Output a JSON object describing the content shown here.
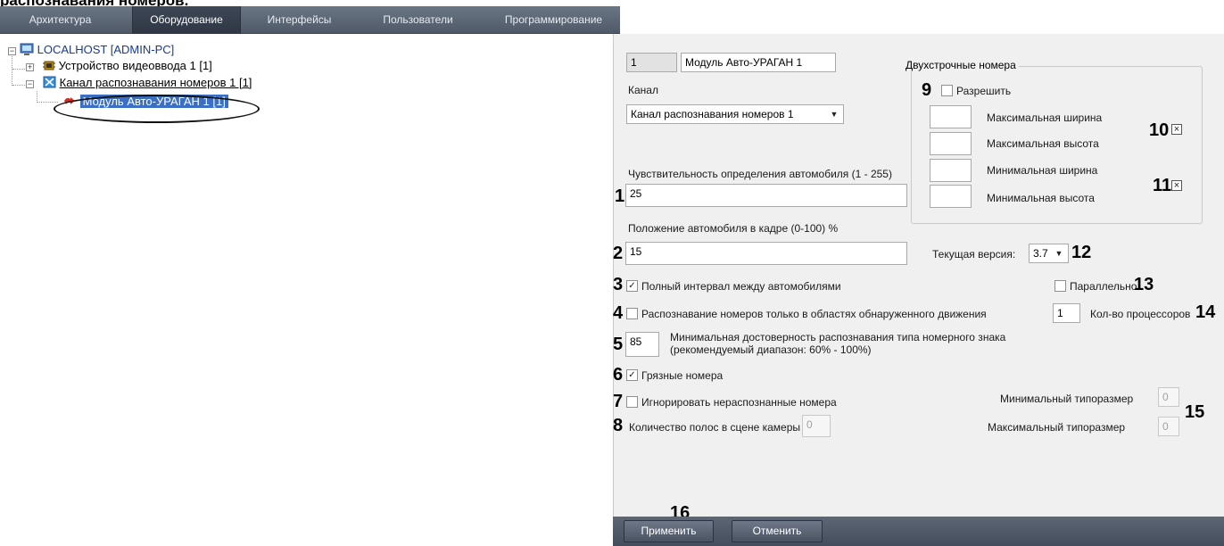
{
  "caption_fragment": "распознавания номеров.",
  "tabs": [
    {
      "label": "Архитектура"
    },
    {
      "label": "Оборудование"
    },
    {
      "label": "Интерфейсы"
    },
    {
      "label": "Пользователи"
    },
    {
      "label": "Программирование"
    }
  ],
  "tree": {
    "root": "LOCALHOST [ADMIN-PC]",
    "video_device": "Устройство видеоввода 1 [1]",
    "recognition_channel": "Канал распознавания номеров 1 [1]",
    "module": "Модуль Авто-УРАГАН 1 [1]"
  },
  "settings": {
    "id_value": "1",
    "name_value": "Модуль Авто-УРАГАН 1",
    "channel_label": "Канал",
    "channel_value": "Канал распознавания номеров 1",
    "sensitivity_label": "Чувствительность определения автомобиля (1 - 255)",
    "sensitivity_value": "25",
    "position_label": "Положение автомобиля в кадре (0-100) %",
    "position_value": "15",
    "full_interval_label": "Полный интервал между автомобилями",
    "full_interval_checked": true,
    "motion_only_label": "Распознавание номеров только в областях обнаруженного движения",
    "motion_only_checked": false,
    "min_confidence_value": "85",
    "min_confidence_label_line1": "Минимальная достоверность распознавания типа номерного знака",
    "min_confidence_label_line2": "(рекомендуемый диапазон: 60% - 100%)",
    "dirty_label": "Грязные номера",
    "dirty_checked": true,
    "ignore_label": "Игнорировать нераспознанные номера",
    "ignore_checked": false,
    "lanes_label": "Количество полос в сцене камеры",
    "lanes_value": "0",
    "two_line": {
      "title": "Двухстрочные номера",
      "allow_label": "Разрешить",
      "allow_checked": false,
      "max_width_label": "Максимальная ширина",
      "max_height_label": "Максимальная высота",
      "min_width_label": "Минимальная ширина",
      "min_height_label": "Минимальная высота"
    },
    "version_label": "Текущая версия:",
    "version_value": "3.7",
    "parallel_label": "Параллельно",
    "parallel_checked": false,
    "cpu_value": "1",
    "cpu_label": "Кол-во процессоров",
    "min_size_label": "Минимальный типоразмер",
    "min_size_value": "0",
    "max_size_label": "Максимальный типоразмер",
    "max_size_value": "0"
  },
  "callouts": {
    "n1": "1",
    "n2": "2",
    "n3": "3",
    "n4": "4",
    "n5": "5",
    "n6": "6",
    "n7": "7",
    "n8": "8",
    "n9": "9",
    "n10": "10",
    "n11": "11",
    "n12": "12",
    "n13": "13",
    "n14": "14",
    "n15": "15",
    "n16": "16"
  },
  "footer": {
    "apply_label": "Применить",
    "cancel_label": "Отменить"
  },
  "colors": {
    "tabbar": "#5a6473",
    "selection": "#3a6fc4",
    "panel_bg": "#f0f0f0"
  }
}
